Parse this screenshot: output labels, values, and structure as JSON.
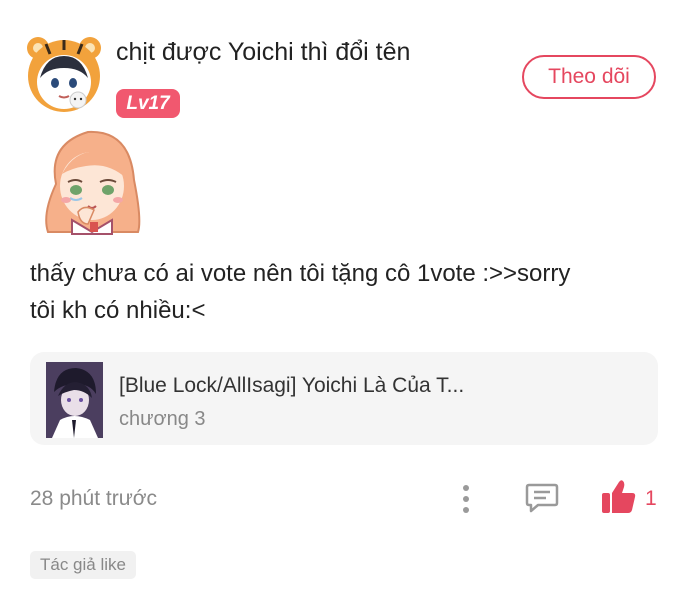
{
  "user": {
    "name": "chịt được Yoichi thì đổi tên",
    "level": "Lv17",
    "follow_label": "Theo dõi"
  },
  "comment": {
    "text_line1": "thấy chưa có ai vote nên tôi tặng cô 1vote :>>sorry",
    "text_line2": "tôi kh có nhiều:<"
  },
  "story": {
    "title": "[Blue Lock/AllIsagi] Yoichi Là Của T...",
    "chapter": "chương 3"
  },
  "meta": {
    "timestamp": "28 phút trước",
    "like_count": "1",
    "author_badge": "Tác giả like"
  },
  "colors": {
    "accent": "#e5475f",
    "level_badge": "#f1586f",
    "card_bg": "#f5f5f5"
  },
  "icons": [
    "tiger-hood-avatar",
    "crying-girl-sticker",
    "more-dots-icon",
    "reply-icon",
    "thumbs-up-icon"
  ]
}
